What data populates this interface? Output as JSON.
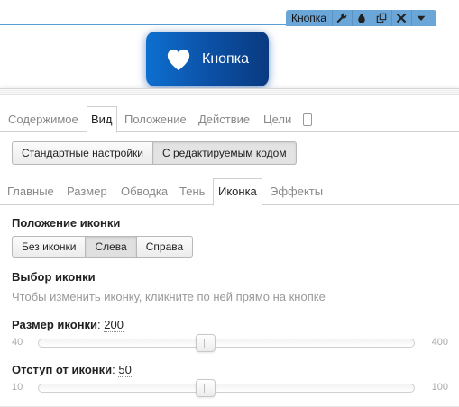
{
  "element_toolbar": {
    "name": "Кнопка",
    "tools": [
      {
        "icon": "wrench-icon"
      },
      {
        "icon": "drop-icon"
      },
      {
        "icon": "duplicate-icon"
      },
      {
        "icon": "delete-icon"
      },
      {
        "icon": "chevron-down-icon"
      }
    ]
  },
  "preview_button": {
    "label": "Кнопка",
    "icon": "heart-icon",
    "colors": {
      "gradient_start": "#0d6fd0",
      "gradient_end": "#0a3a80"
    }
  },
  "top_tabs": [
    {
      "label": "Содержимое",
      "active": false
    },
    {
      "label": "Вид",
      "active": true
    },
    {
      "label": "Положение",
      "active": false
    },
    {
      "label": "Действие",
      "active": false
    },
    {
      "label": "Цели",
      "active": false
    },
    {
      "label": "",
      "active": false,
      "icon": "more-icon"
    }
  ],
  "mode": {
    "options": [
      "Стандартные настройки",
      "С редактируемым кодом"
    ],
    "selected": "С редактируемым кодом"
  },
  "sub_tabs": [
    {
      "label": "Главные",
      "active": false
    },
    {
      "label": "Размер",
      "active": false
    },
    {
      "label": "Обводка",
      "active": false
    },
    {
      "label": "Тень",
      "active": false
    },
    {
      "label": "Иконка",
      "active": true
    },
    {
      "label": "Эффекты",
      "active": false
    }
  ],
  "icon_position": {
    "title": "Положение иконки",
    "options": [
      "Без иконки",
      "Слева",
      "Справа"
    ],
    "selected": "Слева"
  },
  "icon_choice": {
    "title": "Выбор иконки",
    "hint": "Чтобы изменить иконку, кликните по ней прямо на кнопке"
  },
  "icon_size": {
    "title": "Размер иконки",
    "separator": ":",
    "value": "200",
    "min": "40",
    "max": "400",
    "numeric": {
      "value": 200,
      "min": 40,
      "max": 400
    }
  },
  "icon_offset": {
    "title": "Отступ от иконки",
    "separator": ":",
    "value": "50",
    "min": "10",
    "max": "100",
    "numeric": {
      "value": 50,
      "min": 10,
      "max": 100
    }
  }
}
